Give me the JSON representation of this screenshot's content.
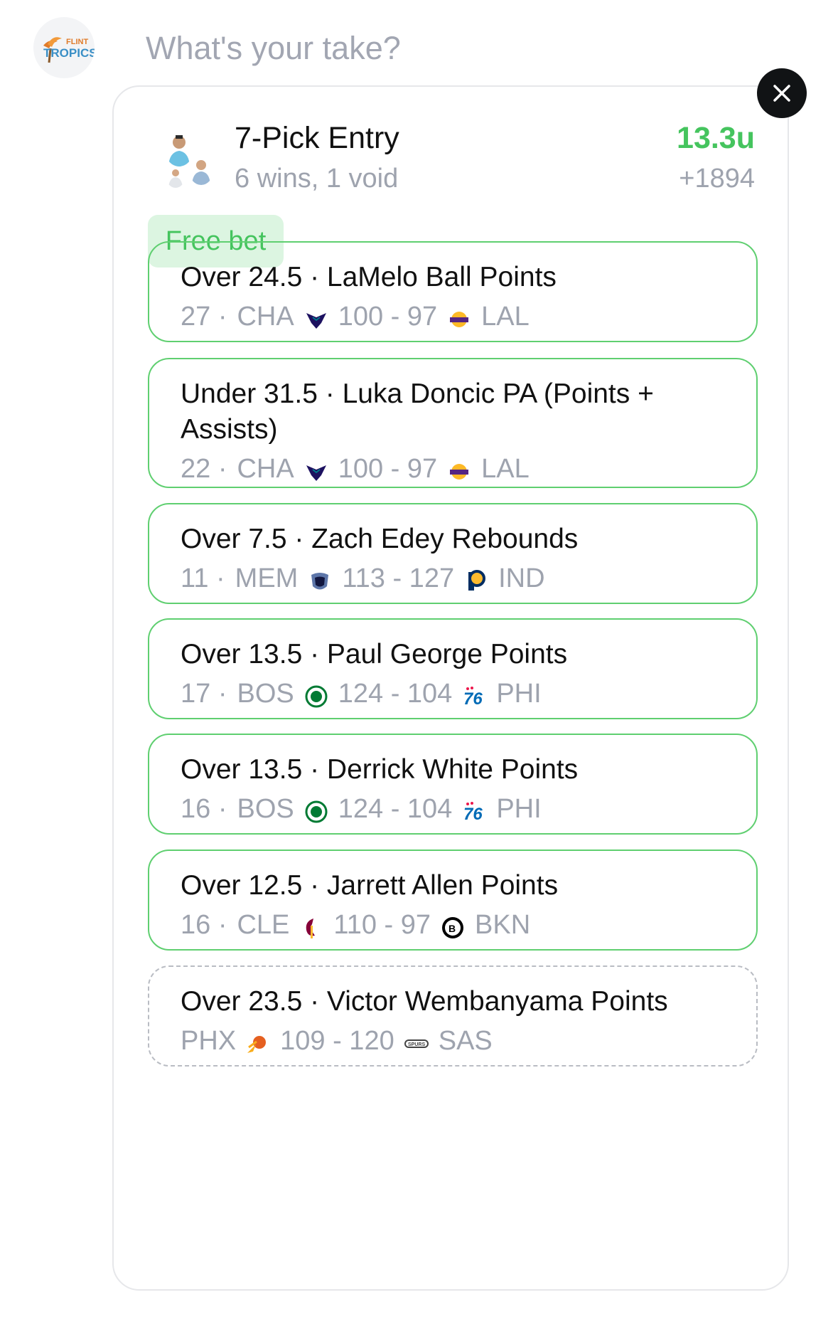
{
  "composer": {
    "avatar_icon": "flint-tropics-logo",
    "prompt_placeholder": "What's your take?"
  },
  "entry": {
    "title": "7-Pick Entry",
    "subtitle": "6 wins, 1 void",
    "payout": "13.3u",
    "odds": "+1894",
    "badge": "Free bet",
    "colors": {
      "win_border": "#5fcf70",
      "payout": "#45c45e",
      "badge_bg": "#dcf5e1",
      "muted": "#9ea3ae"
    }
  },
  "picks": [
    {
      "title": "Over 24.5 · LaMelo Ball Points",
      "prefix": "27 ·",
      "team1": "CHA",
      "score": "100 - 97",
      "team2": "LAL",
      "status": "win",
      "logo1": "hornets-logo-icon",
      "logo2": "lakers-logo-icon"
    },
    {
      "title": "Under 31.5 · Luka Doncic PA (Points + Assists)",
      "prefix": "22 ·",
      "team1": "CHA",
      "score": "100 - 97",
      "team2": "LAL",
      "status": "win",
      "logo1": "hornets-logo-icon",
      "logo2": "lakers-logo-icon"
    },
    {
      "title": "Over 7.5 · Zach Edey Rebounds",
      "prefix": "11 ·",
      "team1": "MEM",
      "score": "113 - 127",
      "team2": "IND",
      "status": "win",
      "logo1": "grizzlies-logo-icon",
      "logo2": "pacers-logo-icon"
    },
    {
      "title": "Over 13.5 · Paul George Points",
      "prefix": "17 ·",
      "team1": "BOS",
      "score": "124 - 104",
      "team2": "PHI",
      "status": "win",
      "logo1": "celtics-logo-icon",
      "logo2": "sixers-logo-icon"
    },
    {
      "title": "Over 13.5 · Derrick White Points",
      "prefix": "16 ·",
      "team1": "BOS",
      "score": "124 - 104",
      "team2": "PHI",
      "status": "win",
      "logo1": "celtics-logo-icon",
      "logo2": "sixers-logo-icon"
    },
    {
      "title": "Over 12.5 · Jarrett Allen Points",
      "prefix": "16 ·",
      "team1": "CLE",
      "score": "110 - 97",
      "team2": "BKN",
      "status": "win",
      "logo1": "cavaliers-logo-icon",
      "logo2": "nets-logo-icon"
    },
    {
      "title": "Over 23.5 · Victor Wembanyama Points",
      "prefix": "",
      "team1": "PHX",
      "score": "109 - 120",
      "team2": "SAS",
      "status": "void",
      "logo1": "suns-logo-icon",
      "logo2": "spurs-logo-icon"
    }
  ]
}
